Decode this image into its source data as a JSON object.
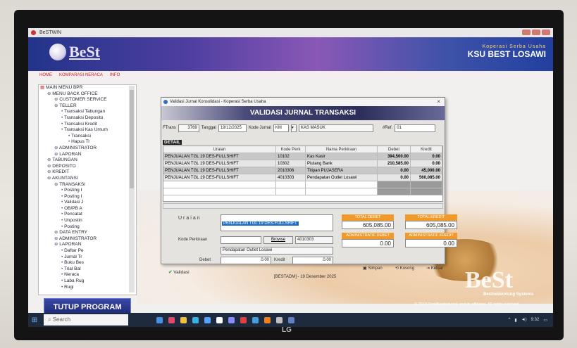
{
  "window": {
    "app_title": "BeSTWIN"
  },
  "banner": {
    "logo": "BeSt",
    "slogan": "Koperasi Serba Usaha",
    "org": "KSU BEST LOSAWI"
  },
  "menubar": {
    "items": [
      "HOME",
      "KOMPARASI NERACA",
      "INFO"
    ]
  },
  "tree": {
    "nodes": [
      {
        "t": "MAIN MENU BPR",
        "d": 0
      },
      {
        "t": "MENU BACK OFFICE",
        "d": 1
      },
      {
        "t": "CUSTOMER SERVICE",
        "d": 2
      },
      {
        "t": "TELLER",
        "d": 2
      },
      {
        "t": "Transaksi Tabungan",
        "d": 3
      },
      {
        "t": "Transaksi Deposito",
        "d": 3
      },
      {
        "t": "Transaksi Kredit",
        "d": 3
      },
      {
        "t": "Transaksi Kas Umum",
        "d": 3
      },
      {
        "t": "Transaksi",
        "d": 4
      },
      {
        "t": "Hapus Tr",
        "d": 4
      },
      {
        "t": "ADMINISTRATOR",
        "d": 2
      },
      {
        "t": "LAPORAN",
        "d": 2
      },
      {
        "t": "TABUNGAN",
        "d": 1
      },
      {
        "t": "DEPOSITO",
        "d": 1
      },
      {
        "t": "KREDIT",
        "d": 1
      },
      {
        "t": "AKUNTANSI",
        "d": 1
      },
      {
        "t": "TRANSAKSI",
        "d": 2
      },
      {
        "t": "Posting I",
        "d": 3
      },
      {
        "t": "Posting I",
        "d": 3
      },
      {
        "t": "Validasi J",
        "d": 3
      },
      {
        "t": "OB/PB A",
        "d": 3
      },
      {
        "t": "Pencatat",
        "d": 3
      },
      {
        "t": "Unpostin",
        "d": 3
      },
      {
        "t": "Posting",
        "d": 3
      },
      {
        "t": "DATA ENTRY",
        "d": 2
      },
      {
        "t": "ADMINISTRATOR",
        "d": 2
      },
      {
        "t": "LAPORAN",
        "d": 2
      },
      {
        "t": "Daftar Pe",
        "d": 3
      },
      {
        "t": "Jurnal Tr",
        "d": 3
      },
      {
        "t": "Buku Bes",
        "d": 3
      },
      {
        "t": "Trial Bal",
        "d": 3
      },
      {
        "t": "Neraca",
        "d": 3
      },
      {
        "t": "Laba Rug",
        "d": 3
      },
      {
        "t": "Rugi",
        "d": 3
      }
    ]
  },
  "tutup": "TUTUP PROGRAM",
  "dialog": {
    "title": "Validasi Jurnal Konsolidasi - Koperasi Serba Usaha",
    "close": "×",
    "heading": "VALIDASI JURNAL TRANSAKSI",
    "ftrans_label": "FTrans",
    "ftrans": "3769",
    "tanggal_label": "Tanggal",
    "tanggal": "19/12/2025",
    "kode_jurnal_label": "Kode Jurnal",
    "kode_jurnal": "KM",
    "kode_jurnal_name": "KAS MASUK",
    "ref_label": "#Ref.",
    "ref": "01",
    "detail": "DETAIL",
    "grid_headers": [
      "Uraian",
      "Kode Perk",
      "Nama Perkiraan",
      "Debet",
      "Kredit"
    ],
    "rows": [
      [
        "PENJUALAN TGL 19 DES-FULLSHIFT",
        "10102",
        "Kas Kasir",
        "394,500.00",
        "0.00"
      ],
      [
        "PENJUALAN TGL 19 DES-FULLSHIFT",
        "10302",
        "Piutang Bank",
        "210,585.00",
        "0.00"
      ],
      [
        "PENJUALAN TGL 19 DES-FULLSHIFT",
        "2010306",
        "Titipan PUJASERA",
        "0.00",
        "45,000.00"
      ],
      [
        "PENJUALAN TGL 19 DES-FULLSHIFT",
        "4010303",
        "Pendapatan Outlet Losawi",
        "0.00",
        "560,085.00"
      ]
    ],
    "uraian_label": "Uraian",
    "uraian": "PENJUALAN TGL 19 DES-FULLSHIFT",
    "kode_perk_label": "Kode Perkiraan",
    "browse": "Browse",
    "kode_perk": "4010303",
    "nama_perk": "Pendapatan Outlet Losawi",
    "debet_label": "Debet",
    "debet": "0.00",
    "kredit_label": "Kredit",
    "kredit": "0.00",
    "total_debet_label": "TOTAL DEBET",
    "total_debet": "605,085.00",
    "total_kredit_label": "TOTAL KREDIT",
    "total_kredit": "605,085.00",
    "adm_debet_label": "ADMINISTRATIF DEBET",
    "adm_debet": "0.00",
    "adm_kredit_label": "ADMINISTRATIF KREDIT",
    "adm_kredit": "0.00",
    "validasi": "Validasi",
    "simpan": "Simpan",
    "kosong": "Kosong",
    "keluar": "Keluar",
    "status": "[BESTADM] - 19 Desember 2025"
  },
  "bg": {
    "brand": "BeSt",
    "sub": "Bestnetworking Systems",
    "copyright": "© 2019 PontiBestnetwork and its affiliates. All rights reserved."
  },
  "taskbar": {
    "search": "Search",
    "time": "9:32"
  },
  "monitor": {
    "brand": "LG"
  }
}
